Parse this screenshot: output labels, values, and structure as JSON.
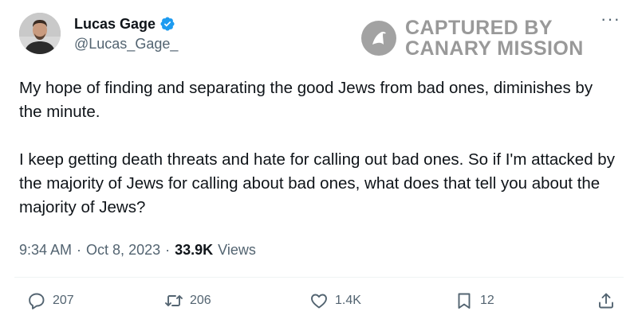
{
  "author": {
    "display_name": "Lucas Gage",
    "handle": "@Lucas_Gage_",
    "verified": true
  },
  "watermark": {
    "line1": "CAPTURED BY",
    "line2": "CANARY MISSION"
  },
  "more_menu": "···",
  "tweet": {
    "paragraph1": "My hope of finding and separating the good Jews from bad ones, diminishes by the minute.",
    "paragraph2": "I keep getting death threats and hate for calling out bad ones. So if I'm attacked by the majority of Jews for calling about bad ones, what does that tell you about the majority of Jews?"
  },
  "meta": {
    "time": "9:34 AM",
    "separator": "·",
    "date": "Oct 8, 2023",
    "views_count": "33.9K",
    "views_label": "Views"
  },
  "actions": {
    "replies": "207",
    "reposts": "206",
    "likes": "1.4K",
    "bookmarks": "12"
  },
  "colors": {
    "text": "#0f1419",
    "secondary": "#536471",
    "verified": "#1d9bf0"
  },
  "icons": [
    "verified-badge-icon",
    "canary-logo-icon",
    "more-icon",
    "reply-icon",
    "repost-icon",
    "like-icon",
    "bookmark-icon",
    "share-icon"
  ]
}
